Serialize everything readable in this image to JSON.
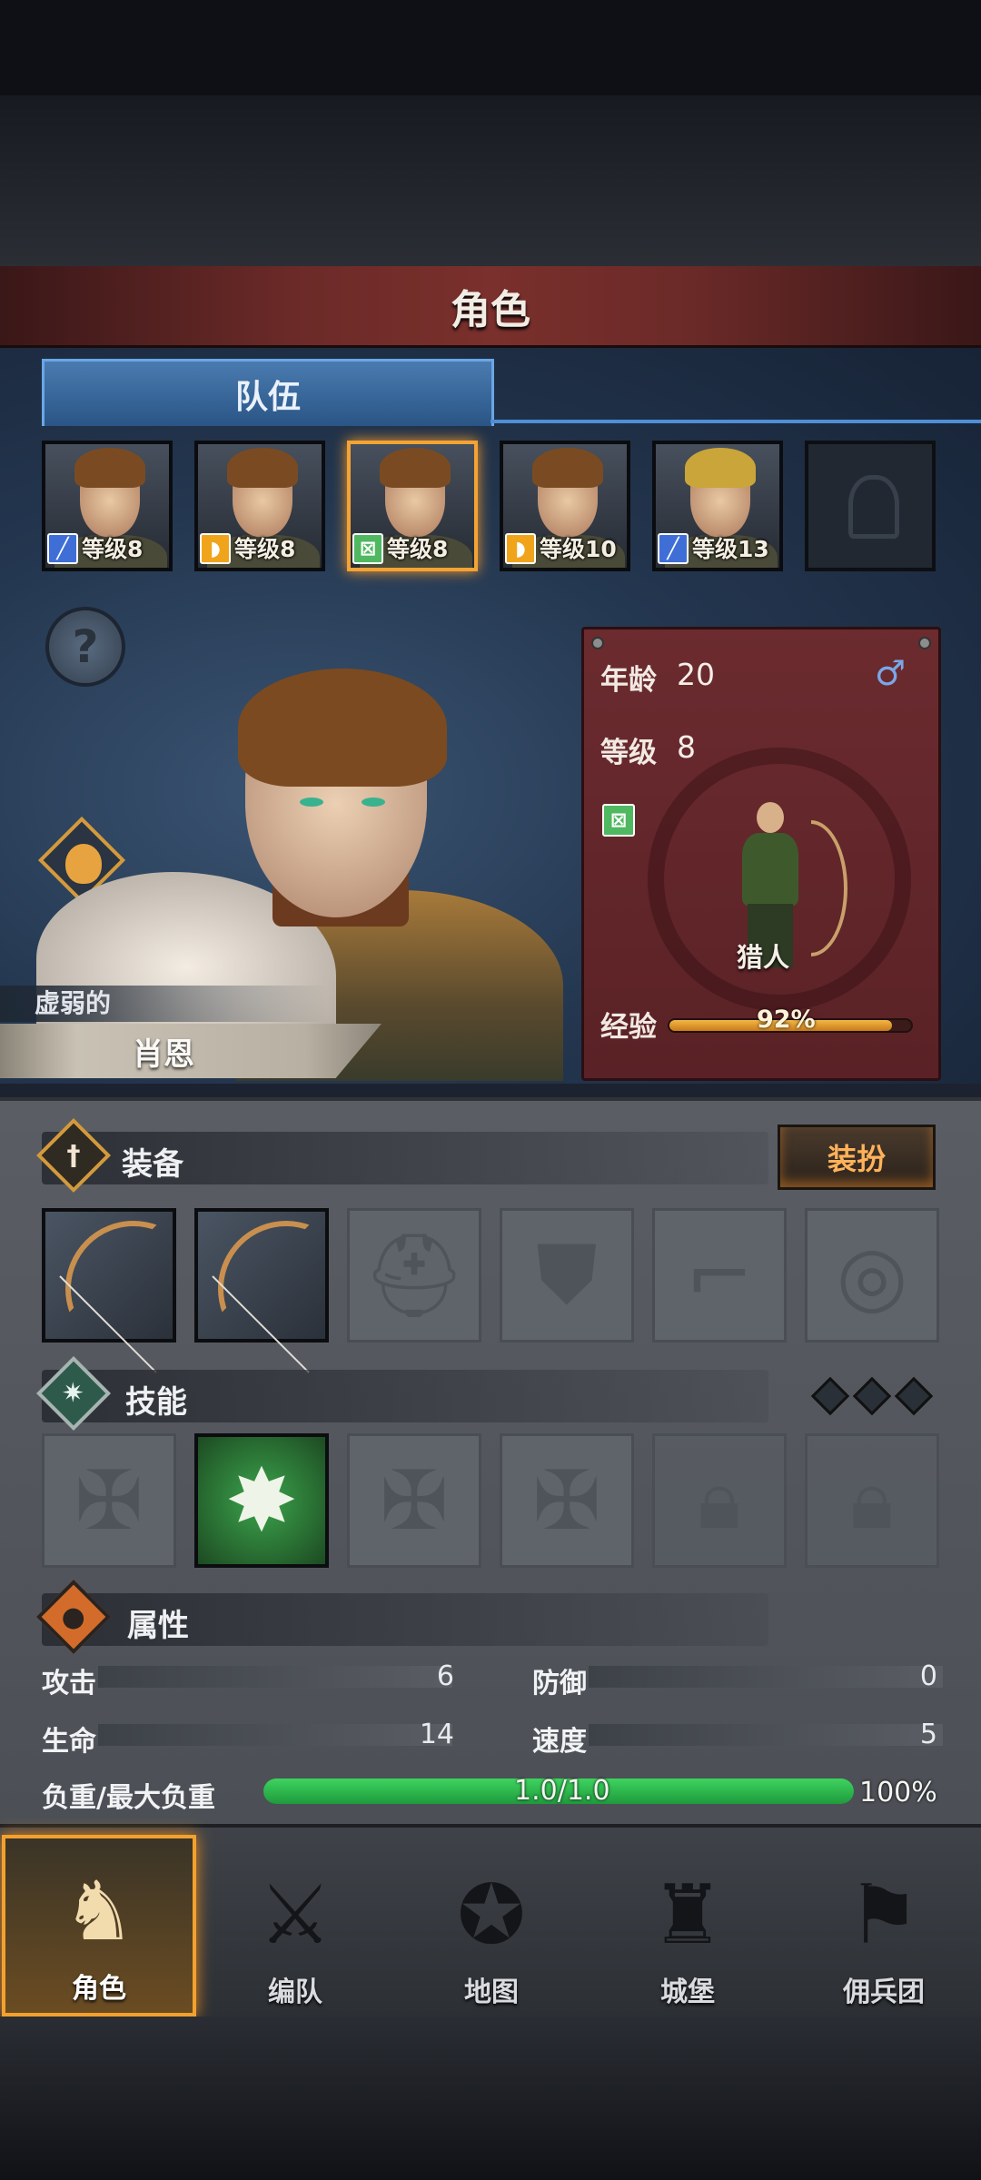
{
  "header": {
    "title": "角色"
  },
  "tabs": [
    {
      "label": "队伍",
      "active": true
    }
  ],
  "team": [
    {
      "role_icon": "sword-icon",
      "level_text": "等级8",
      "hair": "brown",
      "selected": false
    },
    {
      "role_icon": "shield-icon",
      "level_text": "等级8",
      "hair": "brown",
      "selected": false
    },
    {
      "role_icon": "bow-icon",
      "level_text": "等级8",
      "hair": "brown",
      "selected": true
    },
    {
      "role_icon": "shield-icon",
      "level_text": "等级10",
      "hair": "brown",
      "selected": false
    },
    {
      "role_icon": "sword-icon",
      "level_text": "等级13",
      "hair": "blond",
      "selected": false
    },
    {
      "role_icon": "empty-helmet-icon",
      "level_text": "",
      "selected": false
    }
  ],
  "character": {
    "status": "虚弱的",
    "name": "肖恩",
    "age_label": "年龄",
    "age": "20",
    "gender_icon": "male-icon",
    "level_label": "等级",
    "level": "8",
    "class_icon": "bow-icon",
    "class_name": "猎人",
    "exp_label": "经验",
    "exp_text": "92%",
    "exp_fraction": 0.92
  },
  "equipment": {
    "title": "装备",
    "dress_button": "装扮",
    "slots": [
      {
        "icon": "bow-icon",
        "filled": true
      },
      {
        "icon": "bow-icon",
        "filled": true
      },
      {
        "icon": "helmet-icon",
        "filled": false
      },
      {
        "icon": "chest-armor-icon",
        "filled": false
      },
      {
        "icon": "boots-icon",
        "filled": false
      },
      {
        "icon": "ring-icon",
        "filled": false
      }
    ]
  },
  "skills": {
    "title": "技能",
    "slots": [
      {
        "icon": "cross-icon",
        "state": "empty"
      },
      {
        "icon": "arrow-burst-skill-icon",
        "state": "learned"
      },
      {
        "icon": "cross-icon",
        "state": "empty"
      },
      {
        "icon": "cross-icon",
        "state": "empty"
      },
      {
        "icon": "lock-icon",
        "state": "locked"
      },
      {
        "icon": "lock-icon",
        "state": "locked"
      }
    ],
    "points_gems": 3
  },
  "attributes": {
    "title": "属性",
    "attack_label": "攻击",
    "attack": "6",
    "defense_label": "防御",
    "defense": "0",
    "hp_label": "生命",
    "hp": "14",
    "speed_label": "速度",
    "speed": "5",
    "load_label": "负重/最大负重",
    "load_text": "1.0/1.0",
    "load_percent": "100%",
    "load_fraction": 1.0
  },
  "nav": [
    {
      "label": "角色",
      "icon": "knight-icon",
      "active": true
    },
    {
      "label": "编队",
      "icon": "formation-icon",
      "active": false
    },
    {
      "label": "地图",
      "icon": "compass-map-icon",
      "active": false
    },
    {
      "label": "城堡",
      "icon": "castle-icon",
      "active": false
    },
    {
      "label": "佣兵团",
      "icon": "mercenary-banner-icon",
      "active": false
    }
  ],
  "colors": {
    "accent_orange": "#f3a12e",
    "tab_blue": "#4f8fd6",
    "card_red": "#6b2b2f",
    "load_green": "#3ed35f"
  }
}
